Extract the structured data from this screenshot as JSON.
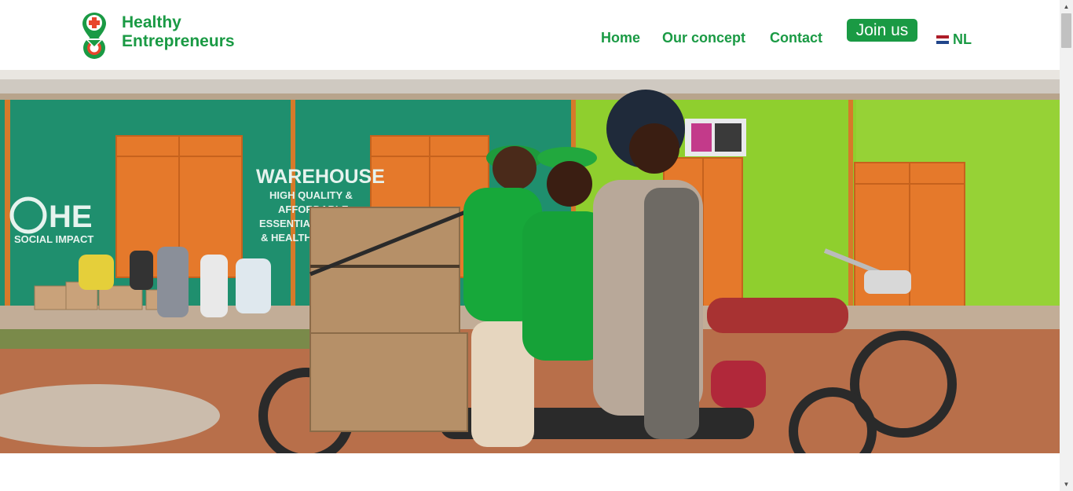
{
  "brand": {
    "line1": "Healthy",
    "line2": "Entrepreneurs",
    "color_primary": "#1a9a44",
    "color_accent": "#e8452c",
    "icon": "location-pin-cross-icon"
  },
  "nav": {
    "items": [
      {
        "label": "Home"
      },
      {
        "label": "Our concept"
      },
      {
        "label": "Contact"
      }
    ],
    "join_label": "Join us",
    "language": {
      "label": "NL",
      "icon": "netherlands-flag-icon"
    }
  },
  "hero": {
    "alt_icon": "hero-photo",
    "storefront_brand": "HE",
    "storefront_brand_sub": "SOCIAL IMPACT",
    "storefront_title": "WAREHOUSE",
    "storefront_lines": [
      "HIGH QUALITY &",
      "AFFORDABLE",
      "ESSENTIAL MEDI...",
      "& HEALTH ..."
    ]
  }
}
